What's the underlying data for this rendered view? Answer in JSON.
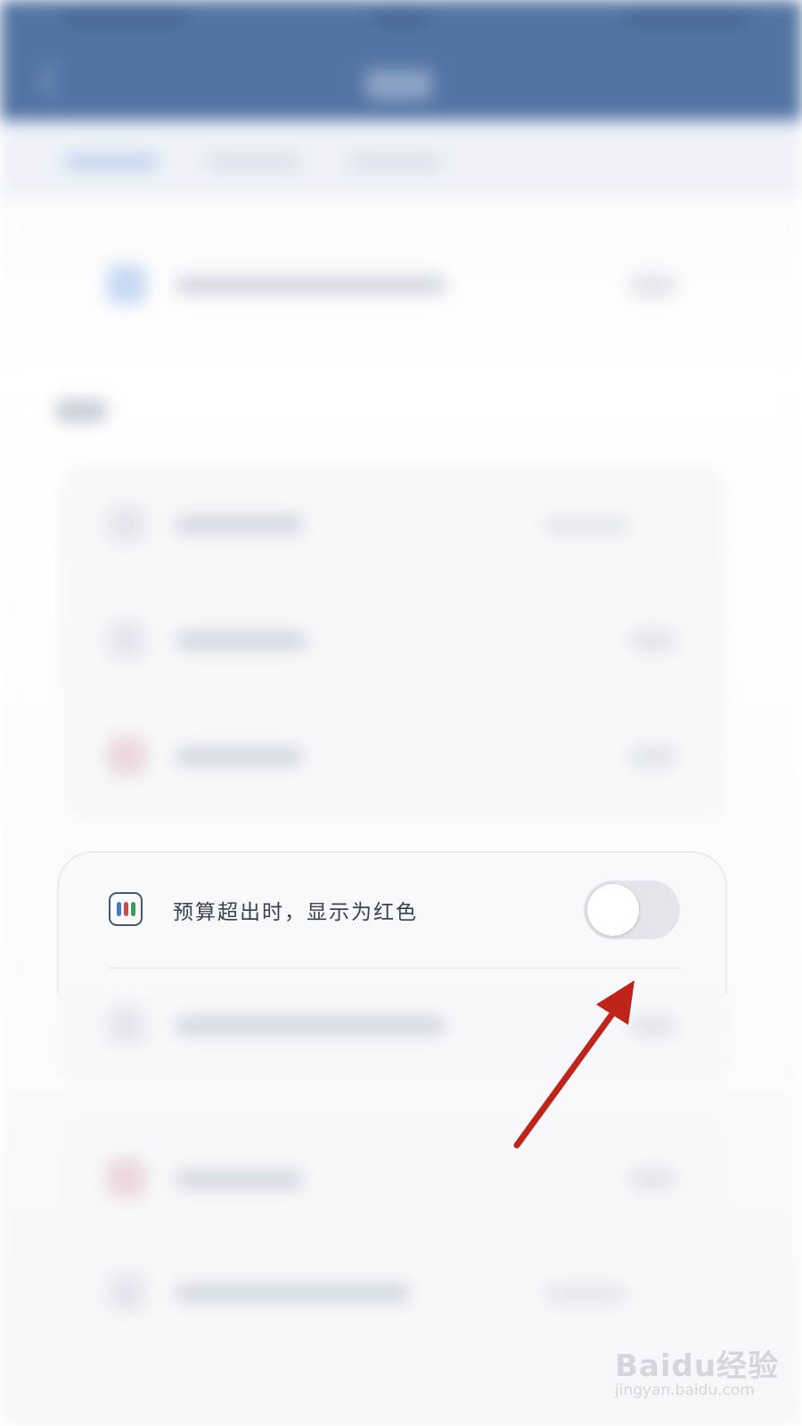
{
  "setting": {
    "label": "预算超出时，显示为红色",
    "toggle_state": "off",
    "icon": "budget-bars-icon",
    "icon_bar_colors": [
      "#4a78c8",
      "#c94a4a",
      "#3c9c5e"
    ]
  },
  "annotation": {
    "arrow_color": "#c0231a"
  },
  "watermark": {
    "brand": "Baidu经验",
    "url": "jingyan.baidu.com"
  },
  "colors": {
    "header": "#5374a3",
    "card_bg": "#f8f9fb",
    "toggle_off": "#e3e5ea",
    "label_text": "#3a4150"
  }
}
